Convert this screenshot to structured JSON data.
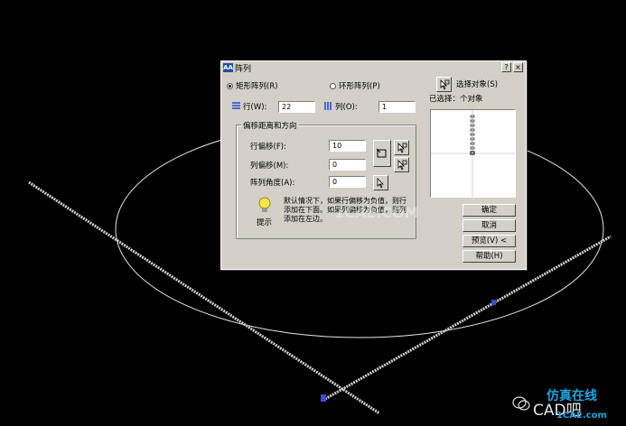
{
  "dialog": {
    "title": "阵列",
    "close_label": "×",
    "help_label": "?",
    "radio_rect": "矩形阵列(R)",
    "radio_polar": "环形阵列(P)",
    "rows_label": "行(W):",
    "rows_value": "22",
    "cols_label": "列(O):",
    "cols_value": "1",
    "offset_group": "偏移距离和方向",
    "row_offset_label": "行偏移(F):",
    "row_offset_value": "10",
    "col_offset_label": "列偏移(M):",
    "col_offset_value": "0",
    "angle_label": "阵列角度(A):",
    "angle_value": "0",
    "hint_text": "默认情况下，如果行偏移为负值，则行添加在下面。如果列偏移为负值，则列添加在左边。",
    "hint_label": "提示",
    "select_objects": "选择对象(S)",
    "selected_count": "已选择：个对象",
    "ok": "确定",
    "cancel": "取消",
    "preview": "预览(V) <",
    "help": "帮助(H)"
  },
  "watermark": {
    "cad": "CAD吧",
    "site": "1CAE.com",
    "brand": "仿真在线",
    "faint": "1CAE.COM"
  },
  "colors": {
    "dialog_bg": "#d4d0c8",
    "canvas_bg": "#000000",
    "accent_text": "#1aa6e0"
  }
}
